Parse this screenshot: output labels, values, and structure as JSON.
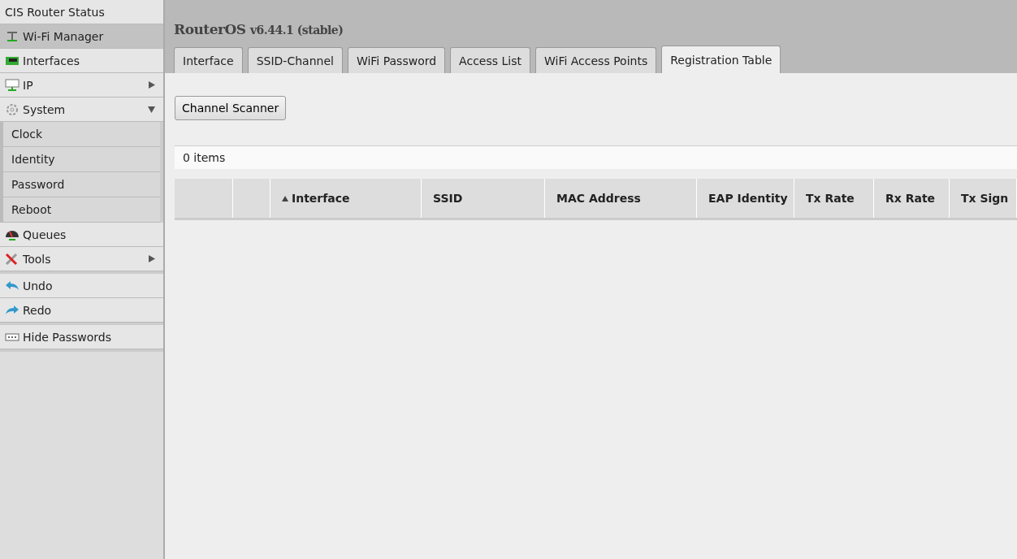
{
  "sidebar": {
    "sections": [
      {
        "items": [
          {
            "label": "CIS Router Status",
            "selected": false
          },
          {
            "label": "Wi-Fi Manager",
            "selected": true
          },
          {
            "label": "Interfaces",
            "selected": false
          },
          {
            "label": "IP",
            "selected": false,
            "expanded": false
          },
          {
            "label": "System",
            "selected": false,
            "expanded": true,
            "children": [
              {
                "label": "Clock"
              },
              {
                "label": "Identity"
              },
              {
                "label": "Password"
              },
              {
                "label": "Reboot"
              }
            ]
          },
          {
            "label": "Queues",
            "selected": false
          },
          {
            "label": "Tools",
            "selected": false,
            "expanded": false
          }
        ]
      },
      {
        "items": [
          {
            "label": "Undo",
            "selected": false
          },
          {
            "label": "Redo",
            "selected": false
          }
        ]
      },
      {
        "items": [
          {
            "label": "Hide Passwords",
            "selected": false
          }
        ]
      }
    ]
  },
  "header": {
    "product": "RouterOS",
    "version": "v6.44.1 (stable)"
  },
  "tabs": [
    {
      "label": "Interface",
      "selected": false
    },
    {
      "label": "SSID-Channel",
      "selected": false
    },
    {
      "label": "WiFi Password",
      "selected": false
    },
    {
      "label": "Access List",
      "selected": false
    },
    {
      "label": "WiFi Access Points",
      "selected": false
    },
    {
      "label": "Registration Table",
      "selected": true
    }
  ],
  "toolbar": {
    "buttons": [
      "Channel Scanner"
    ]
  },
  "table": {
    "count": "0 items",
    "columns": [
      {
        "sorted": false
      },
      {
        "sorted": false
      },
      {
        "label": "Interface",
        "sorted": true
      },
      {
        "label": "SSID",
        "sorted": false
      },
      {
        "label": "MAC Address",
        "sorted": false
      },
      {
        "label": "EAP Identity",
        "sorted": false
      },
      {
        "label": "Tx Rate",
        "sorted": false
      },
      {
        "label": "Rx Rate",
        "sorted": false
      },
      {
        "label": "Tx Sign",
        "sorted": false
      }
    ]
  }
}
